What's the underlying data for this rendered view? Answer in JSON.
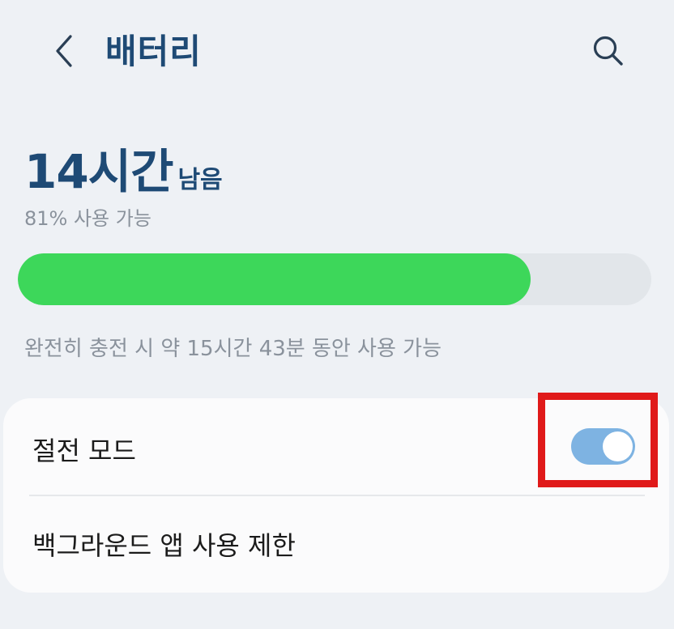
{
  "header": {
    "title": "배터리",
    "back_icon": "chevron-left-icon",
    "search_icon": "search-icon"
  },
  "battery": {
    "remaining_time": "14시간",
    "remaining_suffix": "남음",
    "available_text": "81% 사용 가능",
    "level_percent": 81,
    "full_charge_text": "완전히 충전 시 약 15시간 43분 동안 사용 가능"
  },
  "settings": {
    "power_saving_label": "절전 모드",
    "power_saving_on": true,
    "background_limit_label": "백그라운드 앱 사용 제한"
  },
  "colors": {
    "accent": "#1e4a75",
    "battery_fill": "#3dd75a",
    "toggle_on": "#7eb3e2",
    "highlight": "#e01a1a"
  }
}
